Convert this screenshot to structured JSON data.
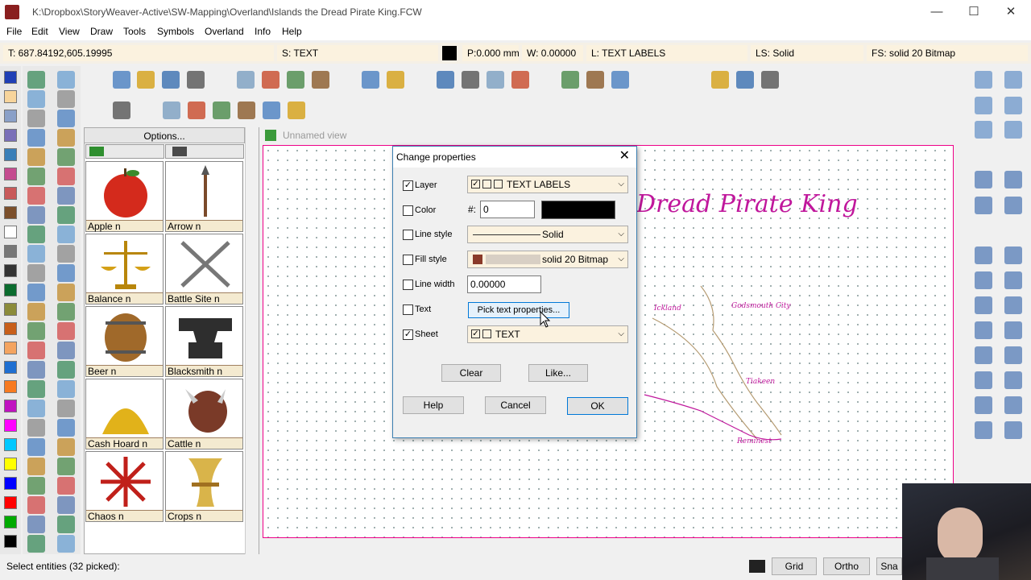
{
  "window": {
    "title": "K:\\Dropbox\\StoryWeaver-Active\\SW-Mapping\\Overland\\Islands the Dread Pirate King.FCW",
    "min": "—",
    "max": "☐",
    "close": "✕"
  },
  "menu": [
    "File",
    "Edit",
    "View",
    "Draw",
    "Tools",
    "Symbols",
    "Overland",
    "Info",
    "Help"
  ],
  "status_fields": {
    "coords": "T: 687.84192,605.19995",
    "sheet": "S: TEXT",
    "pen": "P:0.000 mm",
    "width": "W: 0.00000",
    "layer": "L: TEXT LABELS",
    "line_style": "LS: Solid",
    "fill_style": "FS: solid 20 Bitmap"
  },
  "palette_colors": [
    "#1f3fb5",
    "#f7d49b",
    "#8aa0c8",
    "#7a6fb8",
    "#3a7fb8",
    "#c44b8f",
    "#c85a5a",
    "#7b4f2b",
    "#ffffff",
    "#777777",
    "#333333",
    "#0a6b2e",
    "#8b8b3a",
    "#c85f1a",
    "#f4a460",
    "#1f6fd1",
    "#f77a1f",
    "#c012c0",
    "#ff00ff",
    "#00c8ff",
    "#ffff00",
    "#0000ff",
    "#ff0000",
    "#00aa00",
    "#000000"
  ],
  "symbols_panel": {
    "options_label": "Options...",
    "items": [
      {
        "name": "Apple n"
      },
      {
        "name": "Arrow n"
      },
      {
        "name": "Balance n"
      },
      {
        "name": "Battle Site n"
      },
      {
        "name": "Beer n"
      },
      {
        "name": "Blacksmith n"
      },
      {
        "name": "Cash Hoard n"
      },
      {
        "name": "Cattle n"
      },
      {
        "name": "Chaos n"
      },
      {
        "name": "Crops n"
      }
    ]
  },
  "view": {
    "title": "Unnamed view",
    "map_title": "Dread Pirate King",
    "labels": [
      "Ickland",
      "Godsmouth City",
      "Tiakeen",
      "Reminest"
    ]
  },
  "dialog": {
    "title": "Change properties",
    "rows": [
      {
        "label": "Layer",
        "checked": true,
        "value": "TEXT LABELS"
      },
      {
        "label": "Color",
        "checked": false,
        "hash": "#:",
        "value": "0"
      },
      {
        "label": "Line style",
        "checked": false,
        "value": "Solid"
      },
      {
        "label": "Fill style",
        "checked": false,
        "value": "solid 20 Bitmap"
      },
      {
        "label": "Line width",
        "checked": false,
        "value": "0.00000"
      },
      {
        "label": "Text",
        "checked": false,
        "value": "Pick text properties..."
      },
      {
        "label": "Sheet",
        "checked": true,
        "value": "TEXT"
      }
    ],
    "buttons": {
      "clear": "Clear",
      "like": "Like...",
      "help": "Help",
      "cancel": "Cancel",
      "ok": "OK"
    }
  },
  "bottom": {
    "status": "Select entities (32 picked):",
    "grid": "Grid",
    "ortho": "Ortho",
    "snap": "Sna"
  }
}
